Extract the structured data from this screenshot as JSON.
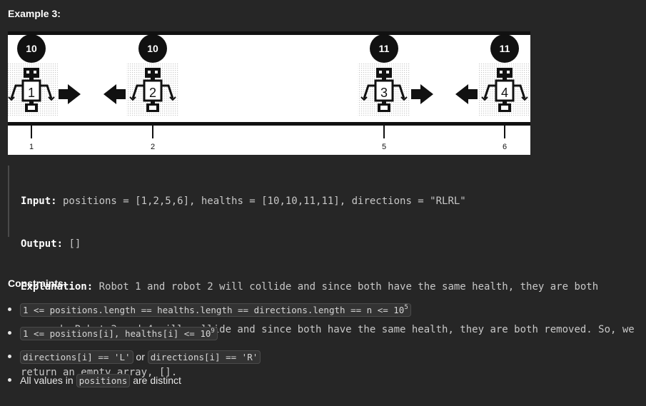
{
  "example": {
    "heading": "Example 3:",
    "robots": [
      {
        "label": "1",
        "health": "10",
        "direction": "right",
        "position": "1"
      },
      {
        "label": "2",
        "health": "10",
        "direction": "left",
        "position": "2"
      },
      {
        "label": "3",
        "health": "11",
        "direction": "right",
        "position": "5"
      },
      {
        "label": "4",
        "health": "11",
        "direction": "left",
        "position": "6"
      }
    ],
    "input_label": "Input:",
    "input_value": " positions = [1,2,5,6], healths = [10,10,11,11], directions = \"RLRL\"",
    "output_label": "Output:",
    "output_value": " []",
    "explanation_label": "Explanation:",
    "explanation_line1": " Robot 1 and robot 2 will collide and since both have the same health, they are both",
    "explanation_line2": "removed. Robot 3 and 4 will collide and since both have the same health, they are both removed. So, we",
    "explanation_line3": "return an empty array, []."
  },
  "constraints": {
    "heading": "Constraints:",
    "item1_code": "1 <= positions.length == healths.length == directions.length == n <= 10",
    "item1_sup": "5",
    "item2_code": "1 <= positions[i], healths[i] <= 10",
    "item2_sup": "9",
    "item3_code_a": "directions[i] == 'L'",
    "item3_or": " or ",
    "item3_code_b": "directions[i] == 'R'",
    "item4_text_a": "All values in ",
    "item4_code": "positions",
    "item4_text_b": " are distinct"
  }
}
